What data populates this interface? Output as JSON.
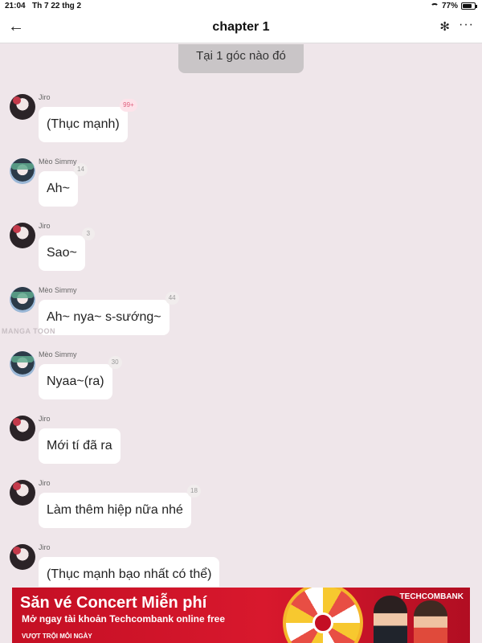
{
  "status_bar": {
    "time": "21:04",
    "date": "Th 7 22 thg 2",
    "battery": "77%"
  },
  "nav": {
    "title": "chapter 1",
    "back_icon": "←",
    "gear_icon": "✻",
    "more_icon": "···"
  },
  "scene_chip": "Tại 1 góc nào đó",
  "watermark": "MANGA TOON",
  "messages": [
    {
      "sender": "Jiro",
      "text": "(Thục mạnh)",
      "count": "99+"
    },
    {
      "sender": "Mèo Simmy",
      "text": "Ah~",
      "count": "14"
    },
    {
      "sender": "Jiro",
      "text": "Sao~",
      "count": "3"
    },
    {
      "sender": "Mèo Simmy",
      "text": "Ah~ nya~ s-sướng~",
      "count": "44"
    },
    {
      "sender": "Mèo Simmy",
      "text": "Nyaa~(ra)",
      "count": "30"
    },
    {
      "sender": "Jiro",
      "text": "Mới tí đã ra",
      "count": ""
    },
    {
      "sender": "Jiro",
      "text": "Làm thêm hiệp nữa nhé",
      "count": "18"
    },
    {
      "sender": "Jiro",
      "text": "(Thục mạnh bạo nhất có thể)",
      "count": ""
    }
  ],
  "ad": {
    "headline": "Săn vé Concert Miễn phí",
    "sub": "Mở ngay tài khoản Techcombank online free",
    "tag": "VƯỢT TRỘI MỖI NGÀY",
    "brand": "TECHCOMBANK"
  }
}
